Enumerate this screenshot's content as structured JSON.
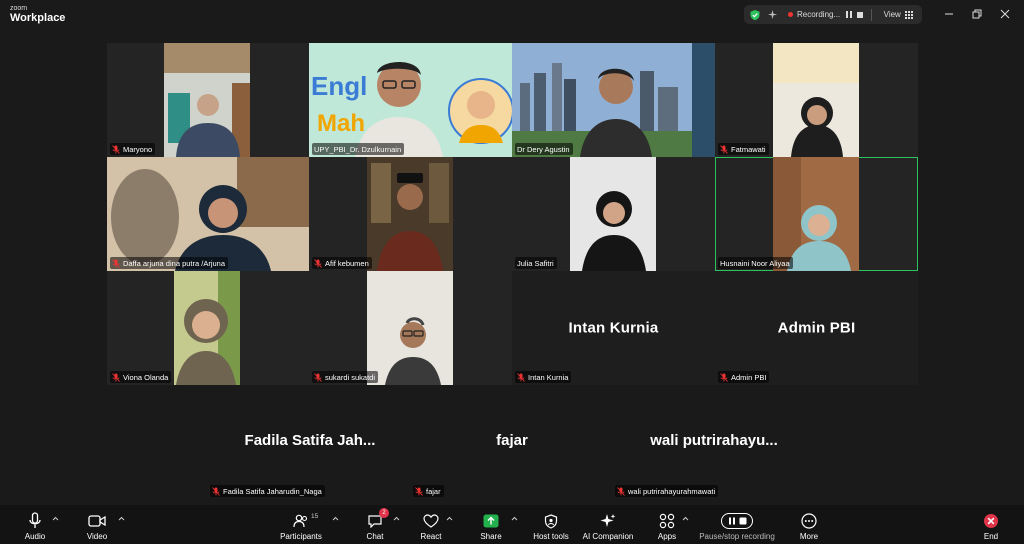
{
  "app": {
    "brand_top": "zoom",
    "brand_bottom": "Workplace"
  },
  "status_bar": {
    "recording_label": "Recording...",
    "view_label": "View"
  },
  "participants": [
    {
      "name": "Maryono",
      "bg": "#2a2a2a",
      "video_bg": "#8d8a7e",
      "accent": "#3d4a63",
      "muted": true
    },
    {
      "name": "UPY_PBI_Dr. Dzulkurnain",
      "bg": "#f2e29a",
      "video_bg": "#b9e4d4",
      "accent": "#f0a500",
      "muted": false
    },
    {
      "name": "Dr Dery Agustin",
      "bg": "#3c6c9a",
      "video_bg": "#6d8fb6",
      "accent": "#2d2d2d",
      "muted": false
    },
    {
      "name": "Fatmawati",
      "bg": "#2a2a2a",
      "video_bg": "#e8e3d8",
      "accent": "#1e1e1e",
      "muted": true
    },
    {
      "name": "Daffa arjuna dina putra /Arjuna",
      "bg": "#b8a48c",
      "video_bg": "#c8b79f",
      "accent": "#1c2a3a",
      "muted": true
    },
    {
      "name": "Afif kebumen",
      "bg": "#2a2a2a",
      "video_bg": "#3b2f24",
      "accent": "#6a2a1e",
      "muted": true
    },
    {
      "name": "Julia Safitri",
      "bg": "#2a2a2a",
      "video_bg": "#e2e2e2",
      "accent": "#151515",
      "muted": false
    },
    {
      "name": "Husnaini Noor Aliyaa",
      "bg": "#2a2a2a",
      "video_bg": "#9c6a45",
      "accent": "#8fc4c9",
      "muted": false
    },
    {
      "name": "Viona Olanda",
      "bg": "#2a2a2a",
      "video_bg": "#b8bf8c",
      "accent": "#6f6450",
      "muted": true
    },
    {
      "name": "sukardi sukatdi",
      "bg": "#2a2a2a",
      "video_bg": "#e4e1dc",
      "accent": "#3a3a3a",
      "muted": true
    },
    {
      "name": "Intan Kurnia",
      "display": "Intan Kurnia",
      "muted": true
    },
    {
      "name": "Admin PBI",
      "display": "Admin PBI",
      "muted": true
    }
  ],
  "bottom_participants": [
    {
      "display": "Fadila Satifa Jah...",
      "name": "Fadila Satifa Jaharudin_Naga"
    },
    {
      "display": "fajar",
      "name": "fajar"
    },
    {
      "display": "wali  putrirahayu...",
      "name": "wali putrirahayurahmawati"
    }
  ],
  "toolbar": {
    "audio": "Audio",
    "video": "Video",
    "participants": "Participants",
    "participants_count": "15",
    "chat": "Chat",
    "chat_badge": "2",
    "react": "React",
    "share": "Share",
    "host_tools": "Host tools",
    "ai_companion": "AI Companion",
    "apps": "Apps",
    "pause_stop": "Pause/stop recording",
    "more": "More",
    "end": "End"
  },
  "colors": {
    "active_speaker": "#2ec25e",
    "share_green": "#22b14c",
    "end_red": "#e0344a",
    "recording_red": "#e33333"
  },
  "icons": {
    "shield": "shield-check-icon",
    "ai": "sparkle-icon",
    "mic": "mic-icon",
    "video": "video-camera-icon",
    "participants": "people-icon",
    "chat": "chat-bubble-icon",
    "react": "heart-icon",
    "share": "share-arrow-icon",
    "host": "shield-icon",
    "apps": "apps-icon",
    "record": "record-pause-stop-icon",
    "more": "more-dots-icon",
    "end": "end-x-icon"
  }
}
